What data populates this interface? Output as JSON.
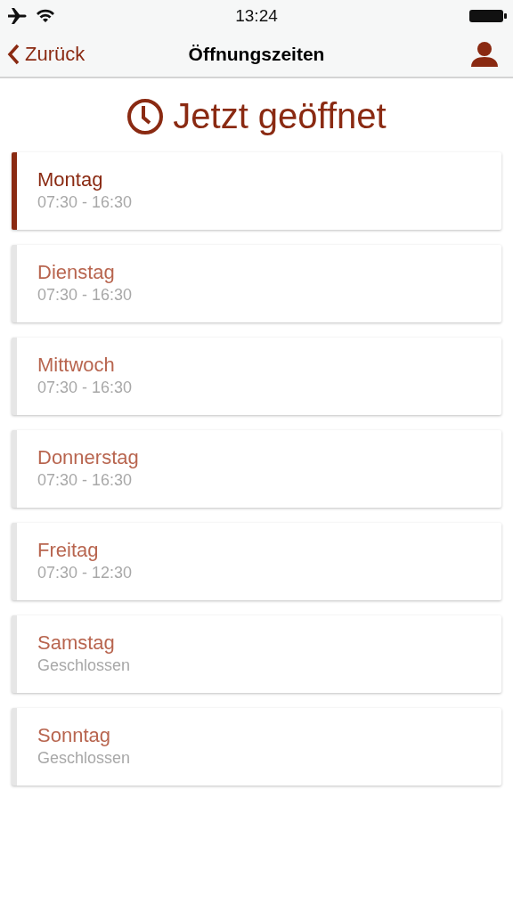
{
  "status_bar": {
    "time": "13:24"
  },
  "nav_bar": {
    "back": "Zurück",
    "title": "Öffnungszeiten"
  },
  "status_heading": "Jetzt geöffnet",
  "days": [
    {
      "name": "Montag",
      "hours": "07:30 - 16:30",
      "selected": true
    },
    {
      "name": "Dienstag",
      "hours": "07:30 - 16:30",
      "selected": false
    },
    {
      "name": "Mittwoch",
      "hours": "07:30 - 16:30",
      "selected": false
    },
    {
      "name": "Donnerstag",
      "hours": "07:30 - 16:30",
      "selected": false
    },
    {
      "name": "Freitag",
      "hours": "07:30 - 12:30",
      "selected": false
    },
    {
      "name": "Samstag",
      "hours": "Geschlossen",
      "selected": false
    },
    {
      "name": "Sonntag",
      "hours": "Geschlossen",
      "selected": false
    }
  ]
}
